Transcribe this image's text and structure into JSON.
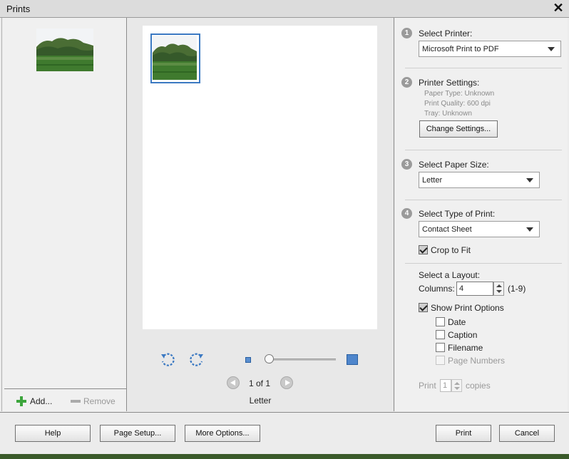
{
  "window": {
    "title": "Prints"
  },
  "left_panel": {
    "add_label": "Add...",
    "remove_label": "Remove"
  },
  "preview": {
    "page_indicator": "1 of 1",
    "paper_label": "Letter",
    "zoom_level": 0.0
  },
  "settings": {
    "step1": {
      "num": "1",
      "title": "Select Printer:",
      "printer": "Microsoft Print to PDF"
    },
    "step2": {
      "num": "2",
      "title": "Printer Settings:",
      "paper_type": "Paper Type: Unknown",
      "print_quality": "Print Quality: 600 dpi",
      "tray": "Tray: Unknown",
      "change_button": "Change Settings..."
    },
    "step3": {
      "num": "3",
      "title": "Select Paper Size:",
      "paper_size": "Letter"
    },
    "step4": {
      "num": "4",
      "title": "Select Type of Print:",
      "print_type": "Contact Sheet",
      "crop_label": "Crop to Fit",
      "crop_checked": true
    },
    "layout": {
      "title": "Select a Layout:",
      "columns_label": "Columns:",
      "columns_value": "4",
      "columns_range": "(1-9)",
      "show_options_label": "Show Print Options",
      "show_options_checked": true,
      "options": [
        {
          "label": "Date",
          "checked": false,
          "enabled": true
        },
        {
          "label": "Caption",
          "checked": false,
          "enabled": true
        },
        {
          "label": "Filename",
          "checked": false,
          "enabled": true
        },
        {
          "label": "Page Numbers",
          "checked": false,
          "enabled": false
        }
      ]
    },
    "copies": {
      "prefix": "Print",
      "value": "1",
      "suffix": "copies"
    }
  },
  "footer": {
    "help": "Help",
    "page_setup": "Page Setup...",
    "more_options": "More Options...",
    "print": "Print",
    "cancel": "Cancel"
  },
  "colors": {
    "accent_blue": "#3b79c2",
    "add_green": "#3da53d"
  }
}
